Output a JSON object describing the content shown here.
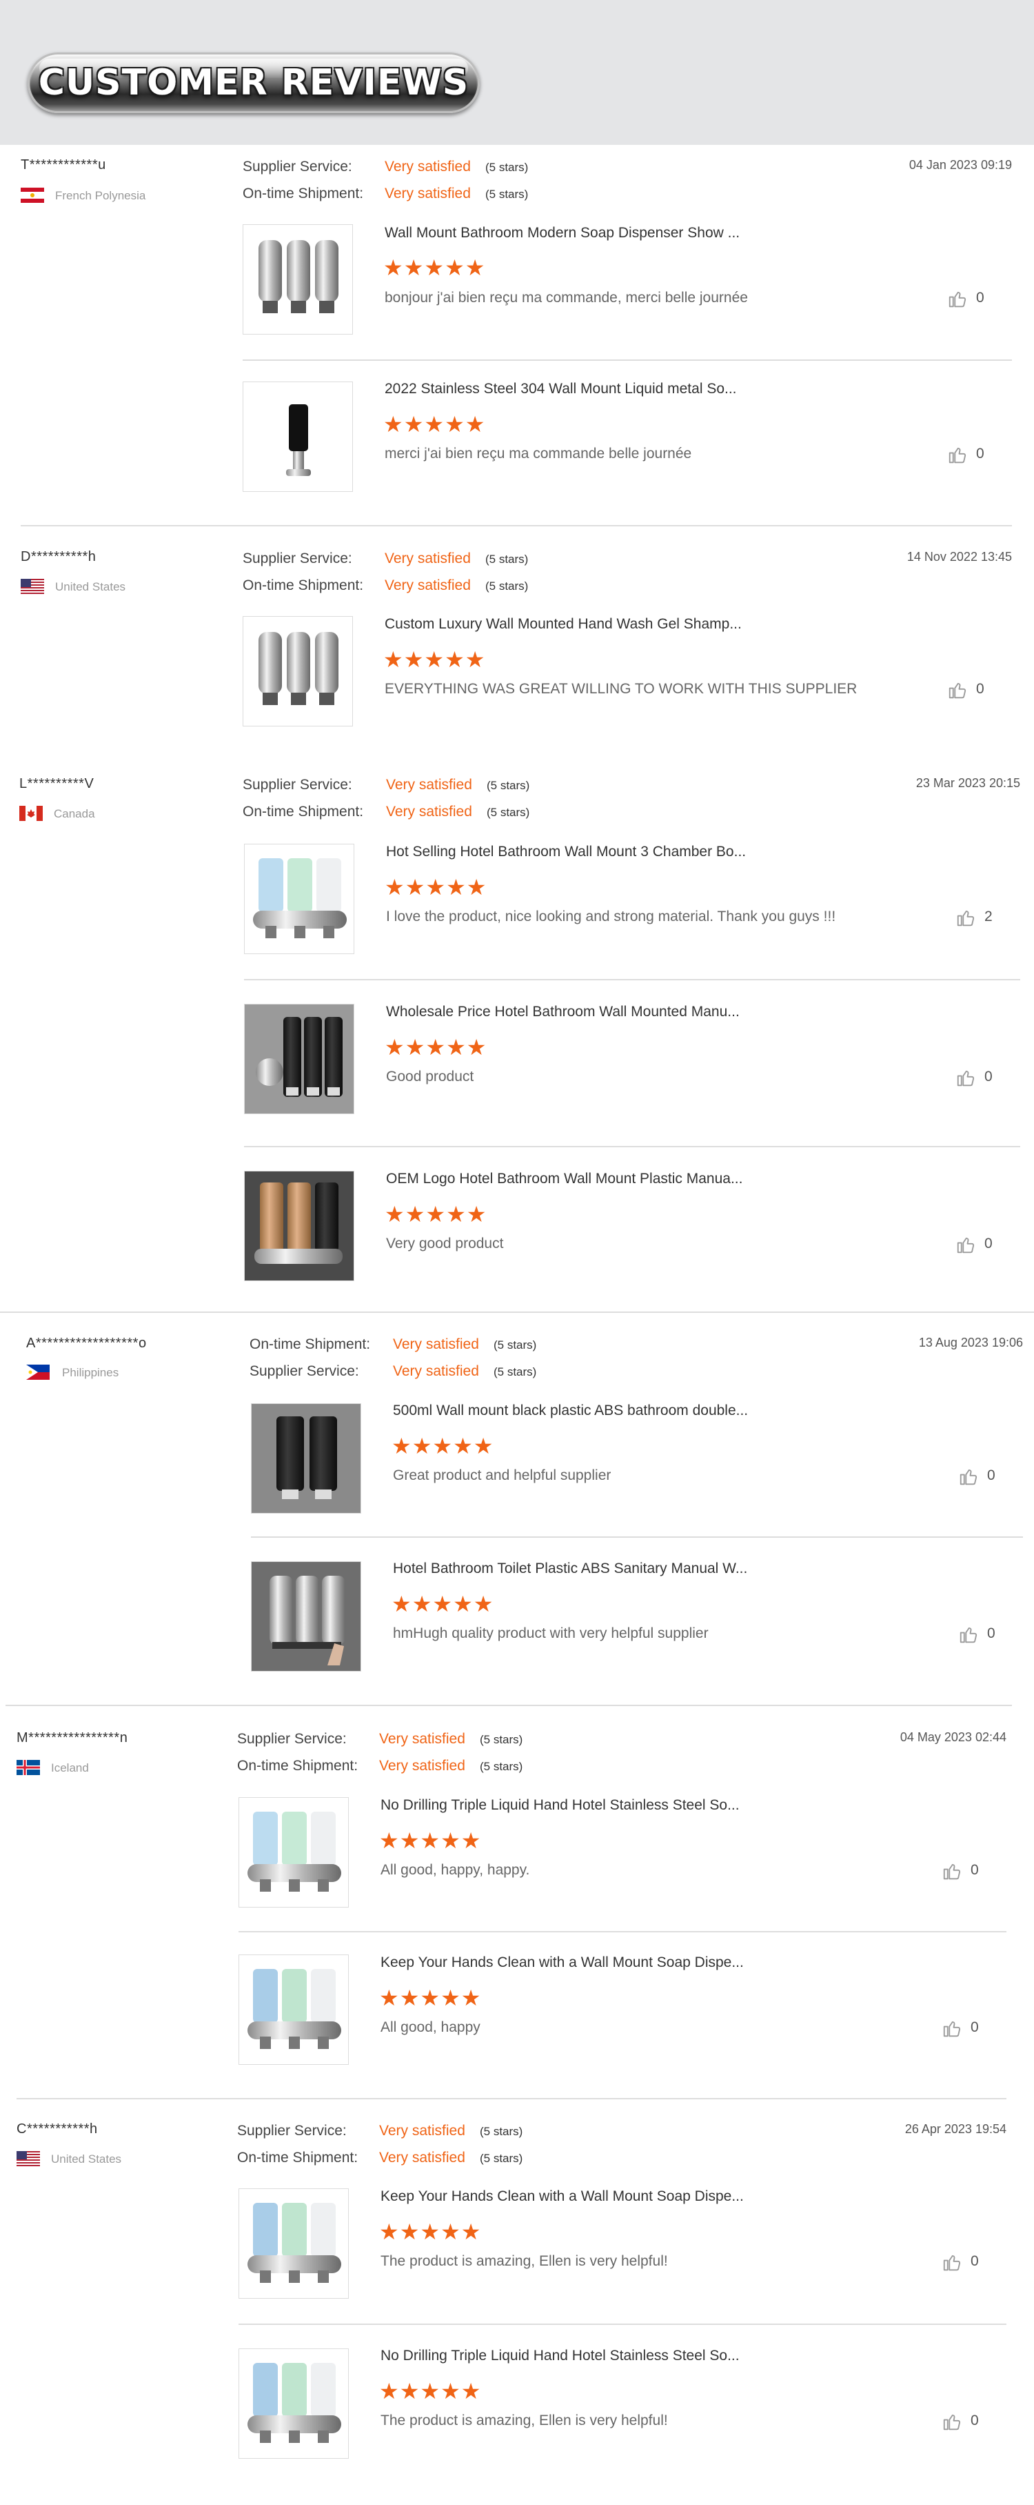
{
  "header": {
    "title": "CUSTOMER REVIEWS"
  },
  "reviews": [
    {
      "buyer": "T************u",
      "country": "French Polynesia",
      "date": "04 Jan 2023 09:19",
      "metrics": [
        {
          "label": "Supplier Service:",
          "value": "Very satisfied",
          "stars": "(5 stars)"
        },
        {
          "label": "On-time Shipment:",
          "value": "Very satisfied",
          "stars": "(5 stars)"
        }
      ],
      "products": [
        {
          "title": "Wall Mount Bathroom Modern Soap Dispenser Show ...",
          "rating": "★★★★★",
          "comment": "bonjour j'ai bien reçu ma commande, merci belle journée",
          "likes": "0"
        },
        {
          "title": "2022 Stainless Steel 304 Wall Mount Liquid metal So...",
          "rating": "★★★★★",
          "comment": "merci j'ai bien reçu ma commande belle journée",
          "likes": "0"
        }
      ]
    },
    {
      "buyer": "D**********h",
      "country": "United States",
      "date": "14 Nov 2022 13:45",
      "metrics": [
        {
          "label": "Supplier Service:",
          "value": "Very satisfied",
          "stars": "(5 stars)"
        },
        {
          "label": "On-time Shipment:",
          "value": "Very satisfied",
          "stars": "(5 stars)"
        }
      ],
      "products": [
        {
          "title": "Custom Luxury Wall Mounted Hand Wash Gel Shamp...",
          "rating": "★★★★★",
          "comment": "EVERYTHING WAS GREAT WILLING TO WORK WITH THIS SUPPLIER",
          "likes": "0"
        }
      ]
    },
    {
      "buyer": "L**********V",
      "country": "Canada",
      "date": "23 Mar 2023 20:15",
      "metrics": [
        {
          "label": "Supplier Service:",
          "value": "Very satisfied",
          "stars": "(5 stars)"
        },
        {
          "label": "On-time Shipment:",
          "value": "Very satisfied",
          "stars": "(5 stars)"
        }
      ],
      "products": [
        {
          "title": "Hot Selling Hotel Bathroom Wall Mount 3 Chamber Bo...",
          "rating": "★★★★★",
          "comment": "I love the product, nice looking and strong material. Thank you guys !!!",
          "likes": "2"
        },
        {
          "title": "Wholesale Price Hotel Bathroom Wall Mounted Manu...",
          "rating": "★★★★★",
          "comment": "Good product",
          "likes": "0"
        },
        {
          "title": "OEM Logo Hotel Bathroom Wall Mount Plastic Manua...",
          "rating": "★★★★★",
          "comment": "Very good product",
          "likes": "0"
        }
      ]
    },
    {
      "buyer": "A******************o",
      "country": "Philippines",
      "date": "13 Aug 2023 19:06",
      "metrics": [
        {
          "label": "On-time Shipment:",
          "value": "Very satisfied",
          "stars": "(5 stars)"
        },
        {
          "label": "Supplier Service:",
          "value": "Very satisfied",
          "stars": "(5 stars)"
        }
      ],
      "products": [
        {
          "title": "500ml Wall mount black plastic ABS bathroom double...",
          "rating": "★★★★★",
          "comment": "Great product and helpful supplier",
          "likes": "0"
        },
        {
          "title": "Hotel Bathroom Toilet Plastic ABS Sanitary Manual W...",
          "rating": "★★★★★",
          "comment": "hmHugh quality product with very helpful supplier",
          "likes": "0"
        }
      ]
    },
    {
      "buyer": "M****************n",
      "country": "Iceland",
      "date": "04 May 2023 02:44",
      "metrics": [
        {
          "label": "Supplier Service:",
          "value": "Very satisfied",
          "stars": "(5 stars)"
        },
        {
          "label": "On-time Shipment:",
          "value": "Very satisfied",
          "stars": "(5 stars)"
        }
      ],
      "products": [
        {
          "title": "No Drilling Triple Liquid Hand Hotel Stainless Steel So...",
          "rating": "★★★★★",
          "comment": "All good, happy, happy.",
          "likes": "0"
        },
        {
          "title": "Keep Your Hands Clean with a Wall Mount Soap Dispe...",
          "rating": "★★★★★",
          "comment": "All good, happy",
          "likes": "0"
        }
      ]
    },
    {
      "buyer": "C***********h",
      "country": "United States",
      "date": "26 Apr 2023 19:54",
      "metrics": [
        {
          "label": "Supplier Service:",
          "value": "Very satisfied",
          "stars": "(5 stars)"
        },
        {
          "label": "On-time Shipment:",
          "value": "Very satisfied",
          "stars": "(5 stars)"
        }
      ],
      "products": [
        {
          "title": "Keep Your Hands Clean with a Wall Mount Soap Dispe...",
          "rating": "★★★★★",
          "comment": "The product is amazing, Ellen is very helpful!",
          "likes": "0"
        },
        {
          "title": "No Drilling Triple Liquid Hand Hotel Stainless Steel So...",
          "rating": "★★★★★",
          "comment": "The product is amazing, Ellen is very helpful!",
          "likes": "0"
        }
      ]
    }
  ]
}
